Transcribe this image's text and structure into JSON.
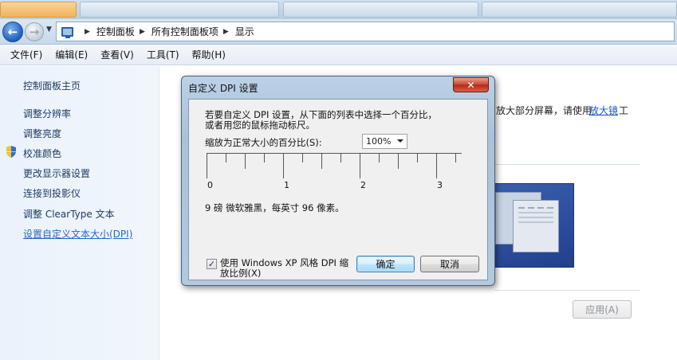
{
  "breadcrumb": [
    "控制面板",
    "所有控制面板项",
    "显示"
  ],
  "menu": [
    "文件(F)",
    "编辑(E)",
    "查看(V)",
    "工具(T)",
    "帮助(H)"
  ],
  "nav": {
    "home": "控制面板主页",
    "links": [
      "调整分辨率",
      "调整亮度",
      "校准颜色",
      "更改显示器设置",
      "连接到投影仪",
      "调整 ClearType 文本",
      "设置自定义文本大小(DPI)"
    ]
  },
  "main": {
    "right_text": "放大部分屏幕，请使用",
    "magnifier_link": "放大镜",
    "trailing_char": "工",
    "apply_label": "应用(A)"
  },
  "dialog": {
    "title": "自定义 DPI 设置",
    "close_label": "✕",
    "instruction_line1": "若要自定义 DPI 设置，从下面的列表中选择一个百分比，",
    "instruction_line2": "或者用您的鼠标拖动标尺。",
    "scale_label": "缩放为正常大小的百分比(S):",
    "scale_value": "100%",
    "ruler_numbers": [
      "0",
      "1",
      "2",
      "3"
    ],
    "font_info": "9 磅 微软雅黑，每英寸 96 像素。",
    "checkbox_line1": "使用 Windows XP 风格 DPI 缩",
    "checkbox_line2": "放比例(X)",
    "checkbox_checked": true,
    "ok_label": "确定",
    "cancel_label": "取消"
  },
  "colors": {
    "link": "#1f3b62",
    "active_link": "#2a67c9",
    "close_red": "#c7432d",
    "accent_blue": "#3c7fb1"
  }
}
